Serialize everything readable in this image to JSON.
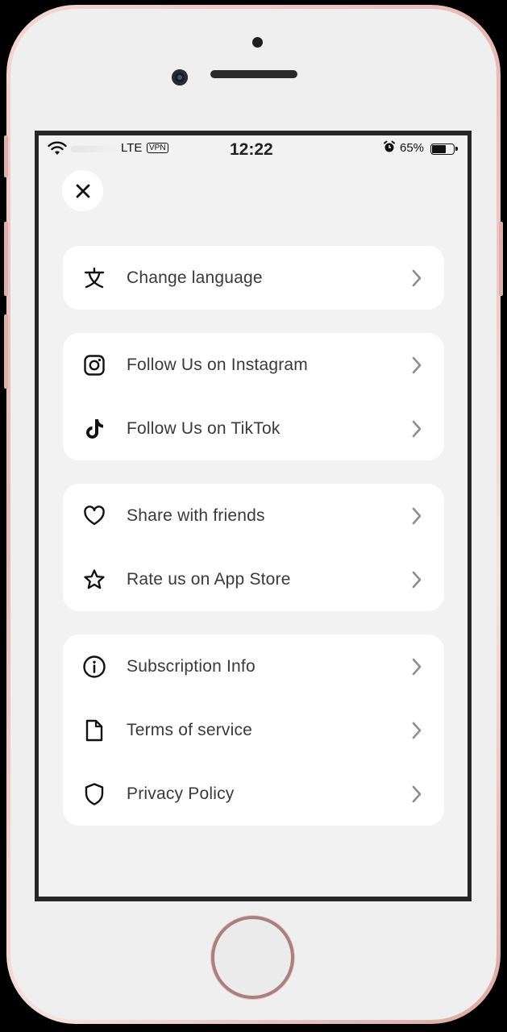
{
  "status_bar": {
    "network": "LTE",
    "vpn": "VPN",
    "time": "12:22",
    "battery_percent": "65%",
    "battery_level": 0.65,
    "icons": [
      "wifi-icon",
      "alarm-icon",
      "battery-icon"
    ]
  },
  "close_icon": "close-icon",
  "menu": {
    "language": [
      {
        "icon": "translate-icon",
        "label": "Change language"
      }
    ],
    "social": [
      {
        "icon": "instagram-icon",
        "label": "Follow Us on Instagram"
      },
      {
        "icon": "tiktok-icon",
        "label": "Follow Us on TikTok"
      }
    ],
    "share": [
      {
        "icon": "heart-icon",
        "label": "Share with friends"
      },
      {
        "icon": "star-icon",
        "label": "Rate us on App Store"
      }
    ],
    "legal": [
      {
        "icon": "info-icon",
        "label": "Subscription Info"
      },
      {
        "icon": "document-icon",
        "label": "Terms of service"
      },
      {
        "icon": "shield-icon",
        "label": "Privacy Policy"
      }
    ]
  },
  "colors": {
    "screen_background": "#f2f2f2",
    "card_background": "#ffffff",
    "label_text": "#3a3a3a",
    "chevron": "#8e8e8e",
    "icon": "#111111",
    "phone_frame": "#e7b9b4"
  }
}
